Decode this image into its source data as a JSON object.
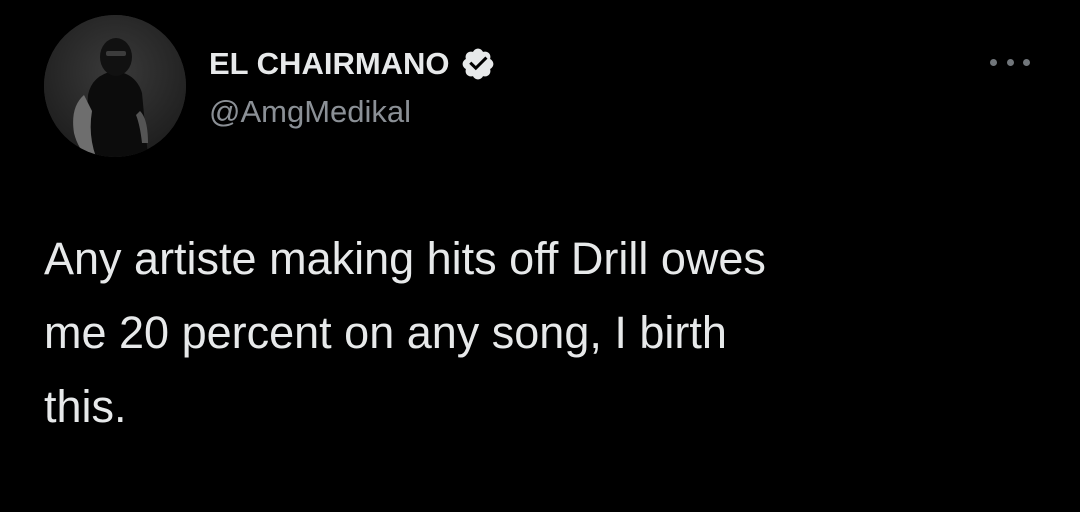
{
  "author": {
    "display_name": "EL CHAIRMANO",
    "handle": "@AmgMedikal",
    "verified": true,
    "avatar_icon": "profile-photo"
  },
  "menu": {
    "icon": "more-horizontal-icon"
  },
  "tweet": {
    "line1": "Any artiste making hits off Drill owes",
    "line2": "me 20 percent on any song, I birth",
    "line3": "this."
  },
  "colors": {
    "background": "#000000",
    "text": "#e7e9ea",
    "secondary_text": "#8b9096",
    "verified_badge": "#e7e9ea"
  }
}
